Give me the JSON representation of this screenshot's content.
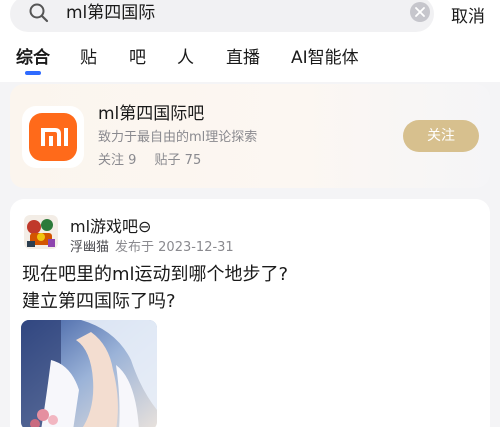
{
  "search": {
    "query": "ml第四国际",
    "cancel_label": "取消"
  },
  "tabs": [
    {
      "label": "综合",
      "active": true
    },
    {
      "label": "贴",
      "active": false
    },
    {
      "label": "吧",
      "active": false
    },
    {
      "label": "人",
      "active": false
    },
    {
      "label": "直播",
      "active": false
    },
    {
      "label": "AI智能体",
      "active": false
    }
  ],
  "forum": {
    "name": "ml第四国际吧",
    "description": "致力于最自由的ml理论探索",
    "followers": "关注 9",
    "posts": "贴子 75",
    "follow_label": "关注",
    "logo_icon": "xiaomi-mi-logo",
    "accent": "#ff6a1a",
    "follow_color": "#d7c08e"
  },
  "post": {
    "forum_name": "ml游戏吧",
    "forum_badge": "⊖",
    "author": "浮幽猫",
    "published": "发布于 2023-12-31",
    "title_line1": "现在吧里的ml运动到哪个地步了?",
    "title_line2": "建立第四国际了吗?"
  },
  "colors": {
    "tab_indicator": "#2f6bff",
    "secondary_text": "#8a8a8f"
  }
}
